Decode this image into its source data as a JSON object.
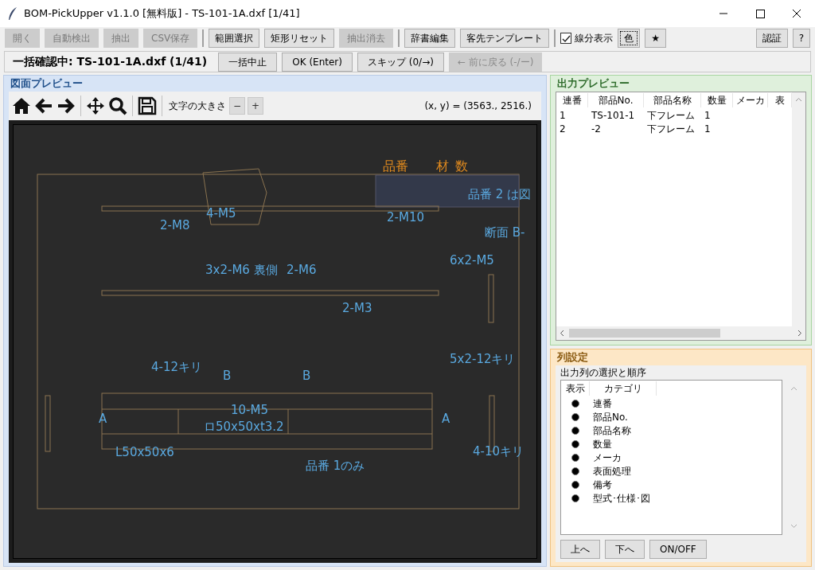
{
  "window": {
    "title": "BOM-PickUpper v1.1.0 [無料版] - TS-101-1A.dxf [1/41]"
  },
  "toolbar": [
    {
      "kind": "button",
      "label": "開く",
      "disabled": true
    },
    {
      "kind": "button",
      "label": "自動検出",
      "disabled": true
    },
    {
      "kind": "button",
      "label": "抽出",
      "disabled": true
    },
    {
      "kind": "button",
      "label": "CSV保存",
      "disabled": true
    },
    {
      "kind": "separator"
    },
    {
      "kind": "button",
      "label": "範囲選択",
      "disabled": false
    },
    {
      "kind": "button",
      "label": "矩形リセット",
      "disabled": false
    },
    {
      "kind": "button",
      "label": "抽出消去",
      "disabled": true
    },
    {
      "kind": "separator"
    },
    {
      "kind": "button",
      "label": "辞書編集",
      "disabled": false
    },
    {
      "kind": "button",
      "label": "客先テンプレート",
      "disabled": false
    },
    {
      "kind": "separator"
    },
    {
      "kind": "checkbox",
      "label": "線分表示",
      "checked": true
    },
    {
      "kind": "button",
      "label": "色",
      "disabled": false,
      "focused": true
    },
    {
      "kind": "button",
      "label": "★",
      "disabled": false
    },
    {
      "kind": "spacer"
    },
    {
      "kind": "button",
      "label": "認証",
      "disabled": false
    },
    {
      "kind": "button",
      "label": "?",
      "disabled": false
    }
  ],
  "batch_bar": {
    "status": "一括確認中: TS-101-1A.dxf (1/41)",
    "buttons": [
      {
        "label": "一括中止",
        "disabled": false
      },
      {
        "label": "OK (Enter)",
        "disabled": false
      },
      {
        "label": "スキップ (0/→)",
        "disabled": false
      },
      {
        "label": "← 前に戻る (-/ー)",
        "disabled": true
      }
    ]
  },
  "drawing_preview": {
    "title": "図面プレビュー",
    "font_size_label": "文字の大きさ",
    "font_size_buttons": [
      "−",
      "+"
    ],
    "coordinates": "(x, y) = (3563., 2516.)",
    "annotations": [
      {
        "text": "品番",
        "kind": "header"
      },
      {
        "text": "材",
        "kind": "header"
      },
      {
        "text": "数",
        "kind": "header"
      },
      {
        "text": "品番 2 は図",
        "kind": "note"
      },
      {
        "text": "4-M5",
        "kind": "note"
      },
      {
        "text": "2-M10",
        "kind": "note"
      },
      {
        "text": "2-M8",
        "kind": "note"
      },
      {
        "text": "断面 B-",
        "kind": "note"
      },
      {
        "text": "6x2-M5",
        "kind": "note"
      },
      {
        "text": "3x2-M6 裏側",
        "kind": "note"
      },
      {
        "text": "2-M6",
        "kind": "note"
      },
      {
        "text": "2-M3",
        "kind": "note"
      },
      {
        "text": "4-12キリ",
        "kind": "note"
      },
      {
        "text": "5x2-12キリ",
        "kind": "note"
      },
      {
        "text": "B",
        "kind": "note"
      },
      {
        "text": "B",
        "kind": "note"
      },
      {
        "text": "10-M5",
        "kind": "note"
      },
      {
        "text": "A",
        "kind": "note"
      },
      {
        "text": "A",
        "kind": "note"
      },
      {
        "text": "ロ50x50xt3.2",
        "kind": "note"
      },
      {
        "text": "L50x50x6",
        "kind": "note"
      },
      {
        "text": "品番 1のみ",
        "kind": "note"
      },
      {
        "text": "4-10キリ",
        "kind": "note"
      }
    ]
  },
  "output_preview": {
    "title": "出力プレビュー",
    "columns": [
      "連番",
      "部品No.",
      "部品名称",
      "数量",
      "メーカ",
      "表"
    ],
    "rows": [
      [
        "1",
        "TS-101-1",
        "下フレーム",
        "1"
      ],
      [
        "2",
        "-2",
        "下フレーム",
        "1"
      ]
    ]
  },
  "column_settings": {
    "title": "列設定",
    "subtitle": "出力列の選択と順序",
    "headers": [
      "表示",
      "カテゴリ"
    ],
    "items": [
      {
        "label": "連番",
        "on": true
      },
      {
        "label": "部品No.",
        "on": true
      },
      {
        "label": "部品名称",
        "on": true
      },
      {
        "label": "数量",
        "on": true
      },
      {
        "label": "メーカ",
        "on": true
      },
      {
        "label": "表面処理",
        "on": true
      },
      {
        "label": "備考",
        "on": true
      },
      {
        "label": "型式･仕様･図",
        "on": true
      }
    ],
    "buttons": [
      "上へ",
      "下へ",
      "ON/OFF"
    ]
  }
}
